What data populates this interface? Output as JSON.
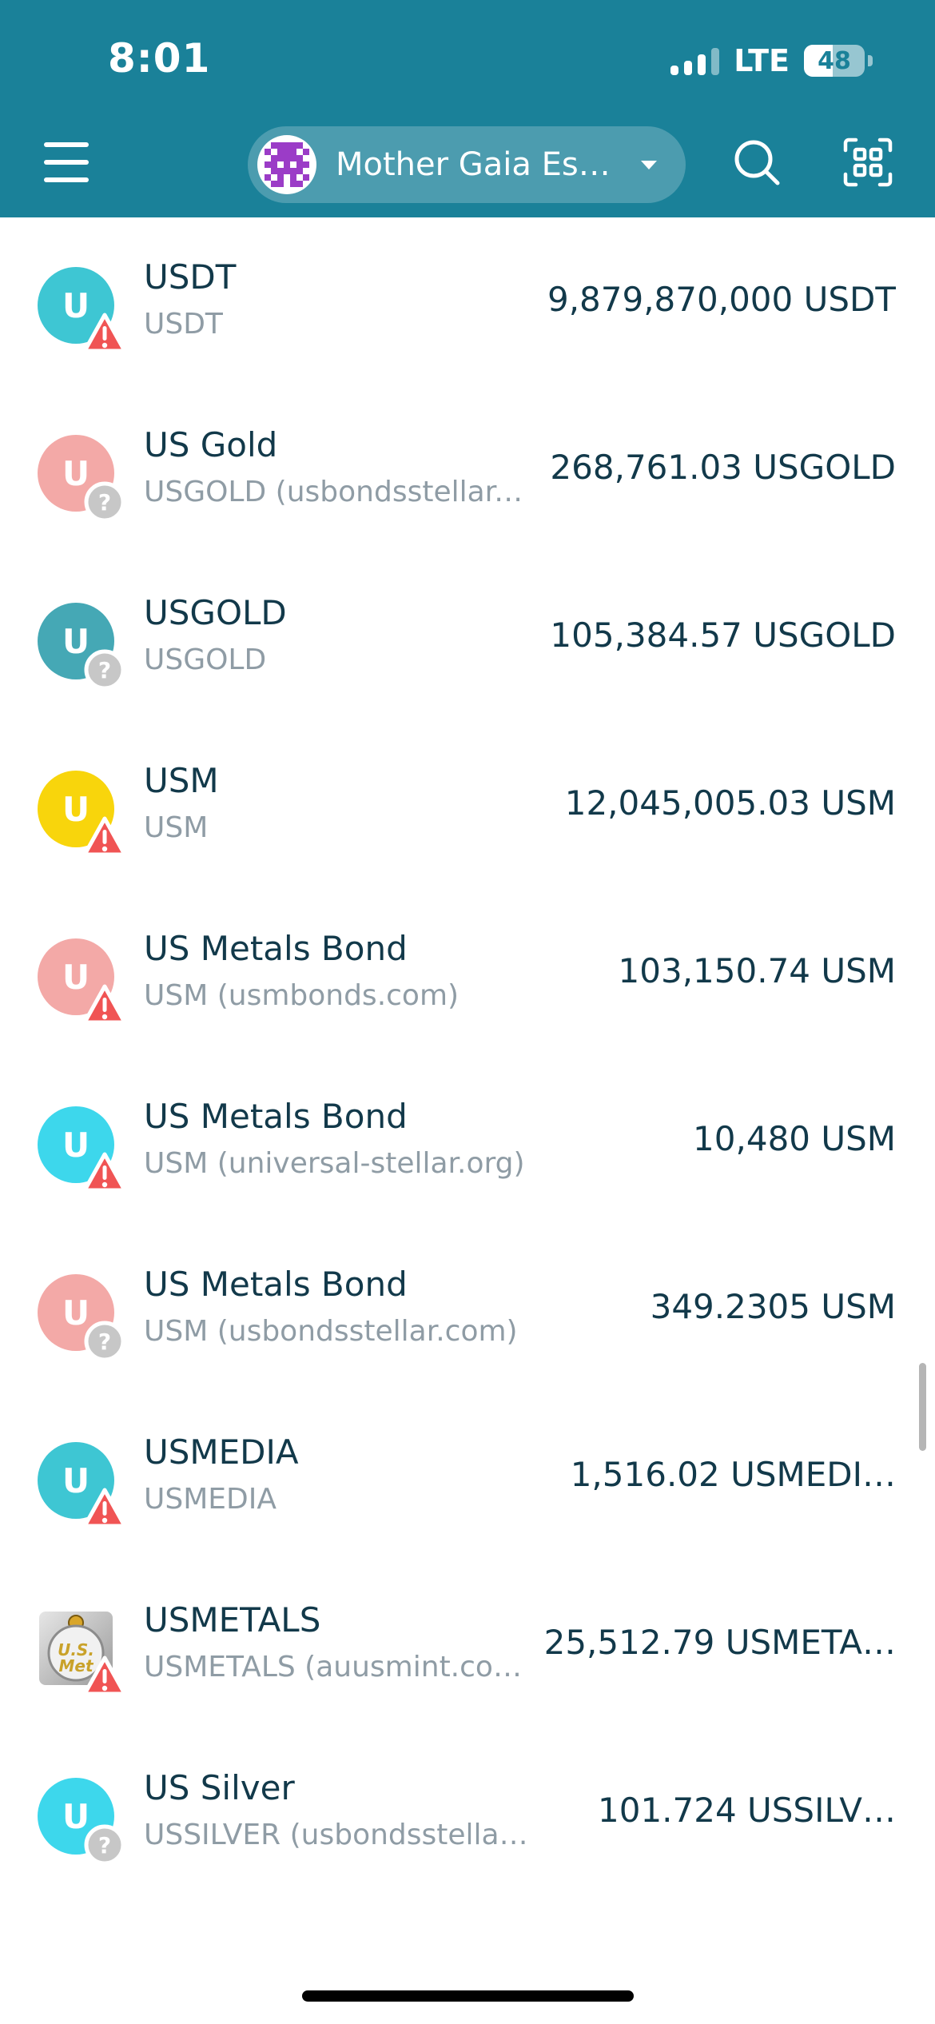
{
  "status_bar": {
    "time": "8:01",
    "network": "LTE",
    "battery": "48",
    "battery_fraction": 0.48
  },
  "header": {
    "account_name": "Mother Gaia Es…",
    "menu_icon": "hamburger-menu-icon",
    "search_icon": "search-icon",
    "scan_icon": "qr-scan-icon",
    "brand_color": "#1a8199"
  },
  "assets": [
    {
      "letter": "U",
      "name": "USDT",
      "code": "USDT",
      "amount": "9,879,870,000 USDT",
      "color": "#3ec6d3",
      "badge": "warning"
    },
    {
      "letter": "U",
      "name": "US Gold",
      "code": "USGOLD (usbondsstellar.…",
      "amount": "268,761.03 USGOLD",
      "color": "#f3a9a7",
      "badge": "unknown"
    },
    {
      "letter": "U",
      "name": "USGOLD",
      "code": "USGOLD",
      "amount": "105,384.57 USGOLD",
      "color": "#45a8b5",
      "badge": "unknown"
    },
    {
      "letter": "U",
      "name": "USM",
      "code": "USM",
      "amount": "12,045,005.03 USM",
      "color": "#f8d50c",
      "badge": "warning"
    },
    {
      "letter": "U",
      "name": "US Metals Bond",
      "code": "USM (usmbonds.com)",
      "amount": "103,150.74 USM",
      "color": "#f3a9a7",
      "badge": "warning"
    },
    {
      "letter": "U",
      "name": "US Metals Bond",
      "code": "USM (universal-stellar.org)",
      "amount": "10,480 USM",
      "color": "#3dd7ec",
      "badge": "warning"
    },
    {
      "letter": "U",
      "name": "US Metals Bond",
      "code": "USM (usbondsstellar.com)",
      "amount": "349.2305 USM",
      "color": "#f3a9a7",
      "badge": "unknown"
    },
    {
      "letter": "U",
      "name": "USMEDIA",
      "code": "USMEDIA",
      "amount": "1,516.02 USMEDI…",
      "color": "#3ec6d3",
      "badge": "warning"
    },
    {
      "letter": "",
      "name": "USMETALS",
      "code": "USMETALS (auusmint.com)",
      "amount": "25,512.79 USMETA…",
      "color": "#cfcfcf",
      "badge": "warning",
      "logo_text": "U.S. Met"
    },
    {
      "letter": "U",
      "name": "US Silver",
      "code": "USSILVER (usbondsstellar.com)",
      "amount": "101.724 USSILV…",
      "color": "#3dd7ec",
      "badge": "unknown"
    }
  ]
}
